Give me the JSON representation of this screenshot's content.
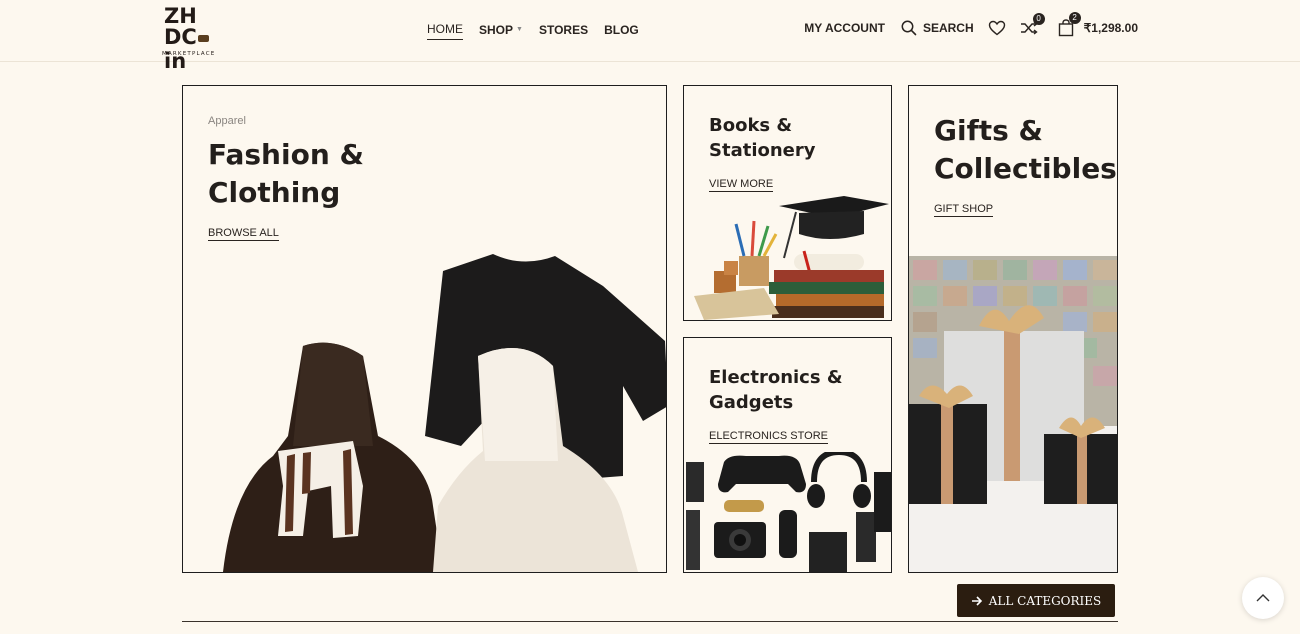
{
  "logo": {
    "line1": "ZH",
    "line2_a": "DC",
    "line2_b": "in",
    "line3": "MARKETPLACE"
  },
  "nav": {
    "items": [
      {
        "label": "HOME",
        "active": true
      },
      {
        "label": "SHOP",
        "has_caret": true
      },
      {
        "label": "STORES"
      },
      {
        "label": "BLOG"
      }
    ]
  },
  "header_right": {
    "account_label": "MY ACCOUNT",
    "search_label": "SEARCH",
    "compare_count": "0",
    "cart_count": "2",
    "cart_total": "₹1,298.00"
  },
  "cards": {
    "fashion": {
      "kicker": "Apparel",
      "title": "Fashion & Clothing",
      "link": "BROWSE ALL"
    },
    "books": {
      "title": "Books & Stationery",
      "link": "VIEW MORE"
    },
    "electronics": {
      "title": "Electronics & Gadgets",
      "link": "ELECTRONICS STORE"
    },
    "gifts": {
      "title": "Gifts & Collectibles",
      "link": "GIFT SHOP"
    }
  },
  "all_categories_label": "ALL CATEGORIES",
  "icons": [
    "search-icon",
    "heart-icon",
    "shuffle-icon",
    "cart-bag-icon",
    "arrow-right-icon",
    "chevron-up-icon"
  ],
  "colors": {
    "background": "#fdf8ef",
    "button_dark": "#2b1d10",
    "text": "#2a2420"
  }
}
